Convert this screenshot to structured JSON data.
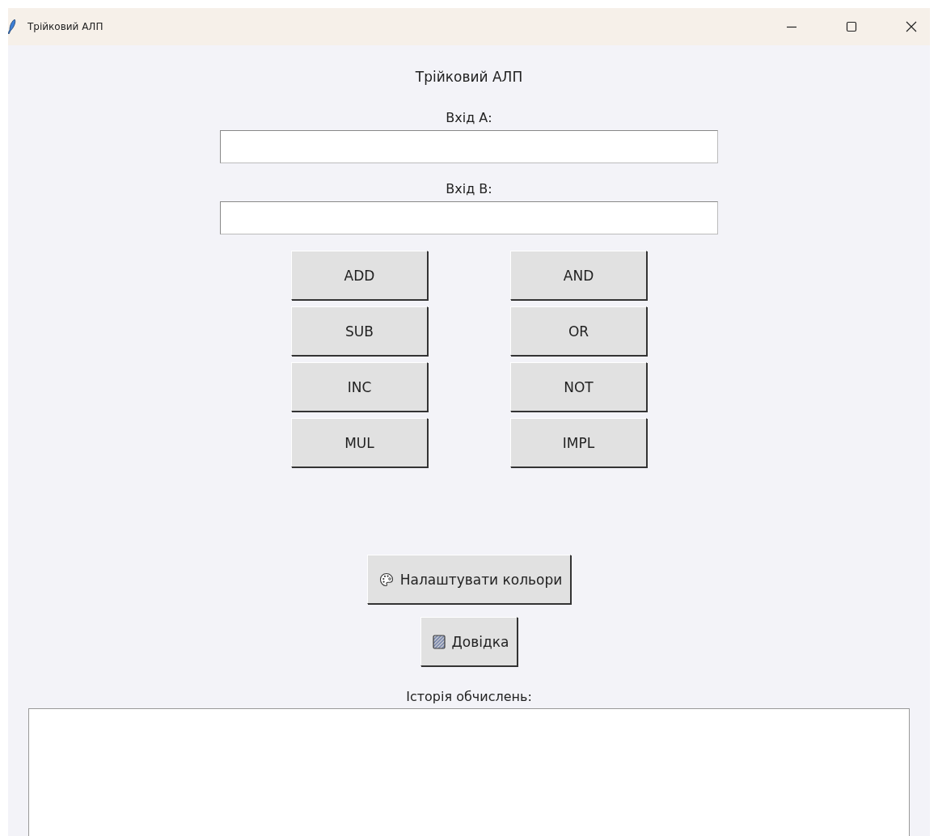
{
  "window": {
    "title": "Трійковий АЛП"
  },
  "heading": "Трійковий АЛП",
  "inputs": [
    {
      "label": "Вхід А:"
    },
    {
      "label": "Вхід В:"
    }
  ],
  "operation_columns": [
    [
      "ADD",
      "SUB",
      "INC",
      "MUL"
    ],
    [
      "AND",
      "OR",
      "NOT",
      "IMPL"
    ]
  ],
  "actions": [
    {
      "kind": "palette",
      "label": "Налаштувати кольори"
    },
    {
      "kind": "book",
      "label": "Довідка"
    }
  ],
  "history": {
    "label": "Історія обчислень:"
  }
}
